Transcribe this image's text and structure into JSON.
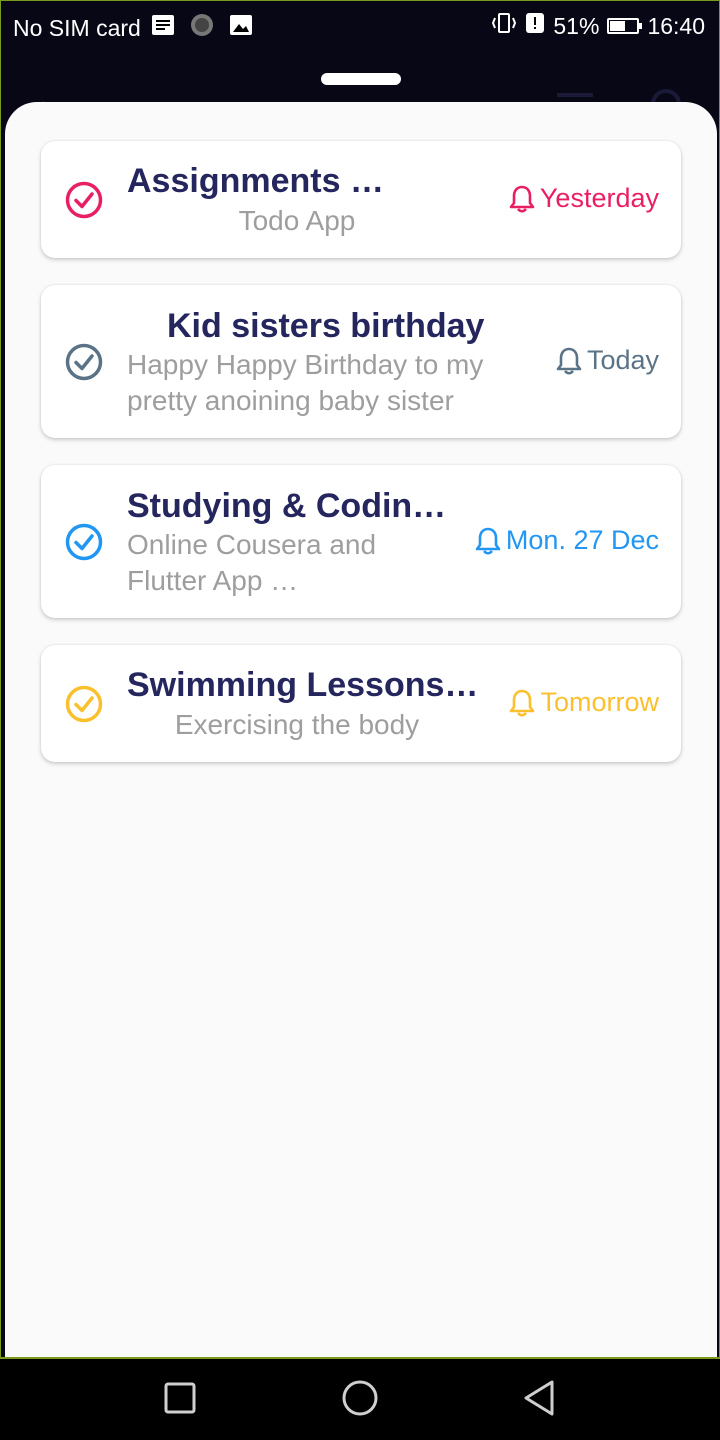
{
  "status_bar": {
    "carrier": "No SIM card",
    "battery": "51%",
    "battery_level": 0.51,
    "time": "16:40"
  },
  "colors": {
    "title": "#25265e",
    "subtitle": "#9e9e9e",
    "pink": "#e91e63",
    "slate": "#5b7386",
    "blue": "#2196f3",
    "amber": "#fbc02d"
  },
  "tasks": [
    {
      "title": "Assignments …",
      "subtitle": "Todo App",
      "reminder": "Yesterday",
      "color": "#e91e63"
    },
    {
      "title": "Kid sisters birthday",
      "subtitle": "Happy Happy Birthday to my pretty anoining baby sister",
      "reminder": "Today",
      "color": "#5b7386"
    },
    {
      "title": "Studying & Codin…",
      "subtitle": "Online Cousera and Flutter App …",
      "reminder": "Mon. 27 Dec",
      "color": "#2196f3"
    },
    {
      "title": "Swimming Lessons…",
      "subtitle": "Exercising the body",
      "reminder": "Tomorrow",
      "color": "#fbc02d"
    }
  ],
  "icons": {
    "check": "check-circle-icon",
    "reminder": "bell-icon",
    "nav": [
      "recents-square-icon",
      "home-circle-icon",
      "back-triangle-icon"
    ]
  }
}
